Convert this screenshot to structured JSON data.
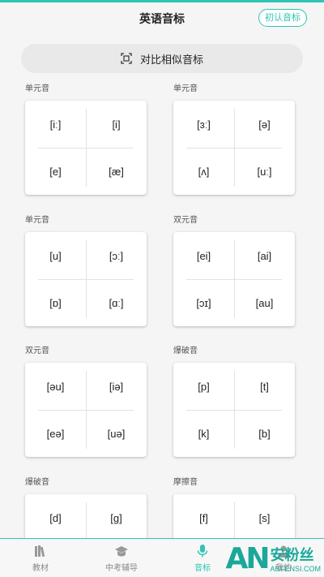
{
  "header": {
    "title": "英语音标",
    "intro_button": "初认音标"
  },
  "compare_button": {
    "label": "对比相似音标",
    "icon": "scan-icon"
  },
  "groups": [
    {
      "label": "单元音",
      "symbols": [
        "[iː]",
        "[i]",
        "[e]",
        "[æ]"
      ]
    },
    {
      "label": "单元音",
      "symbols": [
        "[ɜː]",
        "[ə]",
        "[ʌ]",
        "[uː]"
      ]
    },
    {
      "label": "单元音",
      "symbols": [
        "[u]",
        "[ɔː]",
        "[ɒ]",
        "[ɑː]"
      ]
    },
    {
      "label": "双元音",
      "symbols": [
        "[ei]",
        "[ai]",
        "[ɔɪ]",
        "[au]"
      ]
    },
    {
      "label": "双元音",
      "symbols": [
        "[əu]",
        "[iə]",
        "[eə]",
        "[uə]"
      ]
    },
    {
      "label": "爆破音",
      "symbols": [
        "[p]",
        "[t]",
        "[k]",
        "[b]"
      ]
    },
    {
      "label": "爆破音",
      "symbols": [
        "[d]",
        "[g]",
        "",
        ""
      ]
    },
    {
      "label": "摩擦音",
      "symbols": [
        "[f]",
        "[s]",
        "",
        ""
      ]
    }
  ],
  "tabs": [
    {
      "label": "教材",
      "icon": "books-icon"
    },
    {
      "label": "中考辅导",
      "icon": "graduation-cap-icon"
    },
    {
      "label": "音标",
      "icon": "microphone-icon"
    },
    {
      "label": "我的",
      "icon": "user-icon"
    }
  ],
  "watermark": {
    "logo": "AN",
    "cn": "安粉丝",
    "en": "ANFENSI.COM"
  },
  "colors": {
    "accent": "#2ec4b6"
  }
}
